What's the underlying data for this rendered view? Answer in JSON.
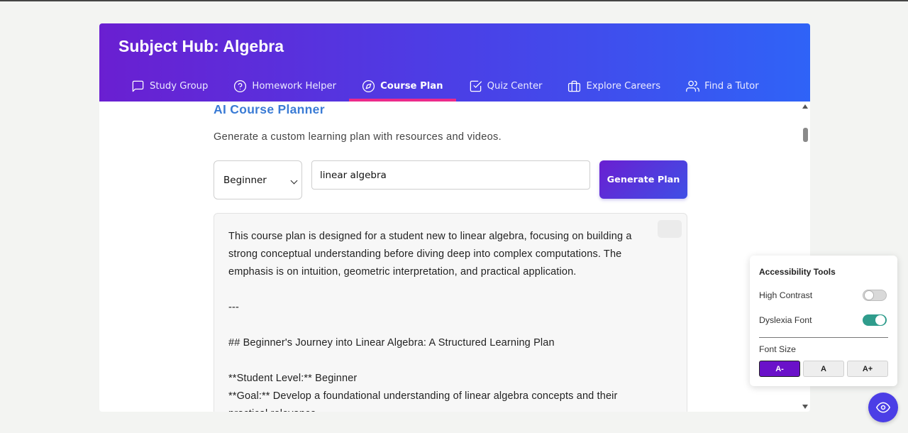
{
  "header": {
    "title": "Subject Hub: Algebra",
    "tabs": [
      {
        "label": "Study Group",
        "icon": "message-square-icon",
        "active": false
      },
      {
        "label": "Homework Helper",
        "icon": "help-circle-icon",
        "active": false
      },
      {
        "label": "Course Plan",
        "icon": "compass-icon",
        "active": true
      },
      {
        "label": "Quiz Center",
        "icon": "check-square-icon",
        "active": false
      },
      {
        "label": "Explore Careers",
        "icon": "briefcase-icon",
        "active": false
      },
      {
        "label": "Find a Tutor",
        "icon": "users-icon",
        "active": false
      }
    ]
  },
  "planner": {
    "title": "AI Course Planner",
    "subtitle": "Generate a custom learning plan with resources and videos.",
    "level_value": "Beginner",
    "topic_value": "linear algebra",
    "generate_label": "Generate Plan",
    "output_lines": [
      "This course plan is designed for a student new to linear algebra, focusing on building a",
      "strong conceptual understanding before diving deep into complex computations. The",
      "emphasis is on intuition, geometric interpretation, and practical application.",
      "",
      "---",
      "",
      "## Beginner's Journey into Linear Algebra: A Structured Learning Plan",
      "",
      "**Student Level:** Beginner",
      "**Goal:** Develop a foundational understanding of linear algebra concepts and their",
      "practical relevance."
    ]
  },
  "accessibility": {
    "title": "Accessibility Tools",
    "high_contrast_label": "High Contrast",
    "high_contrast_on": false,
    "dyslexia_label": "Dyslexia Font",
    "dyslexia_on": true,
    "font_size_label": "Font Size",
    "font_sizes": [
      "A-",
      "A",
      "A+"
    ],
    "active_font_size": "A-"
  },
  "colors": {
    "accent": "#6a1fd1",
    "header_gradient_end": "#2f63f7",
    "active_tab_underline": "#ec2a8a",
    "toggle_on": "#2f9c8c",
    "title_blue": "#3a7bd5"
  }
}
